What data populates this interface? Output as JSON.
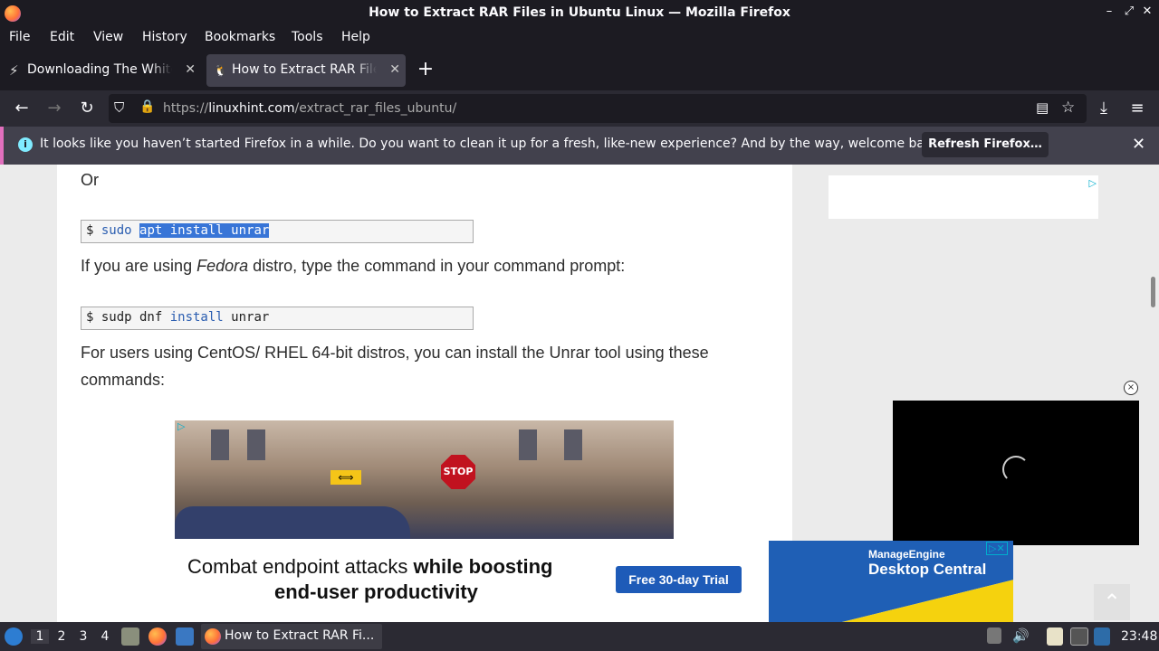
{
  "window": {
    "title": "How to Extract RAR Files in Ubuntu Linux — Mozilla Firefox",
    "controls": [
      "–",
      "⤢",
      "✕"
    ]
  },
  "menu": {
    "items": [
      "File",
      "Edit",
      "View",
      "History",
      "Bookmarks",
      "Tools",
      "Help"
    ]
  },
  "tabs": [
    {
      "label": "Downloading The White House",
      "icon": "⚡"
    },
    {
      "label": "How to Extract RAR Files in Ubuntu Linux",
      "icon": "🐧"
    }
  ],
  "nav": {
    "url_host": "linuxhint.com",
    "url_prefix": "https://",
    "url_path": "/extract_rar_files_ubuntu/"
  },
  "notification": {
    "text": "It looks like you haven’t started Firefox in a while. Do you want to clean it up for a fresh, like-new experience? And by the way, welcome back!",
    "button": "Refresh Firefox…"
  },
  "article": {
    "or": "Or",
    "cmd1": {
      "prompt": "$ ",
      "plain": "sudo ",
      "selected": "apt install unrar"
    },
    "fedora_pre": "If you are using ",
    "fedora_em": "Fedora",
    "fedora_post": " distro, type the command in your command prompt:",
    "cmd2": {
      "prompt": "$ ",
      "a": "sudp dnf ",
      "kw": "install",
      "b": " unrar"
    },
    "centos": "For users using CentOS/ RHEL 64-bit distros, you can install the Unrar tool using these commands:"
  },
  "photo": {
    "stop": "STOP",
    "sign": "⟺"
  },
  "banner": {
    "line1a": "Combat endpoint attacks ",
    "line1b": "while boosting",
    "line2": "end-user productivity",
    "cta": "Free 30-day Trial",
    "brand1": "ManageEngine",
    "brand2": "Desktop Central"
  },
  "taskbar": {
    "workspaces": [
      "1",
      "2",
      "3",
      "4"
    ],
    "task": "How to Extract RAR Fi...",
    "clock": "23:48"
  }
}
